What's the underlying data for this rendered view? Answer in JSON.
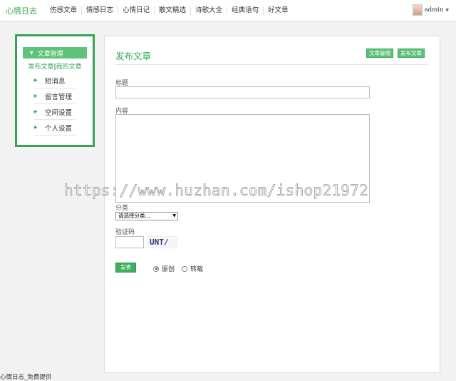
{
  "header": {
    "brand": "心情日志",
    "nav": [
      "伤感文章",
      "情感日志",
      "心情日记",
      "散文精选",
      "诗歌大全",
      "经典语句",
      "好文章"
    ],
    "user_name": "admin"
  },
  "sidebar": {
    "section_title": "文章管理",
    "sub_links": {
      "publish": "发布文章",
      "separator": "|",
      "mine": "我的文章"
    },
    "items": [
      {
        "label": "短消息"
      },
      {
        "label": "留言管理"
      },
      {
        "label": "空间设置"
      },
      {
        "label": "个人设置"
      }
    ]
  },
  "main": {
    "title": "发布文章",
    "btn_manage": "文章管理",
    "btn_publish": "发布文章",
    "title_label": "标题",
    "content_label": "内容",
    "category_label": "分类",
    "category_value": "请选择分类...",
    "captcha_label": "验证码",
    "captcha_text": "UNT/",
    "submit_label": "发表",
    "radio_original": "原创",
    "radio_repost": "转载",
    "selected_type": "原创"
  },
  "watermark": "https://www.huzhan.com/ishop21972",
  "footer": "心情日志_免费提供",
  "colors": {
    "accent": "#2fa54f",
    "sidebar_border": "#33a556",
    "button": "#5cc07a"
  },
  "icons": [
    "avatar",
    "chevron-down-icon",
    "chevron-right-icon",
    "dropdown-arrow-icon"
  ]
}
